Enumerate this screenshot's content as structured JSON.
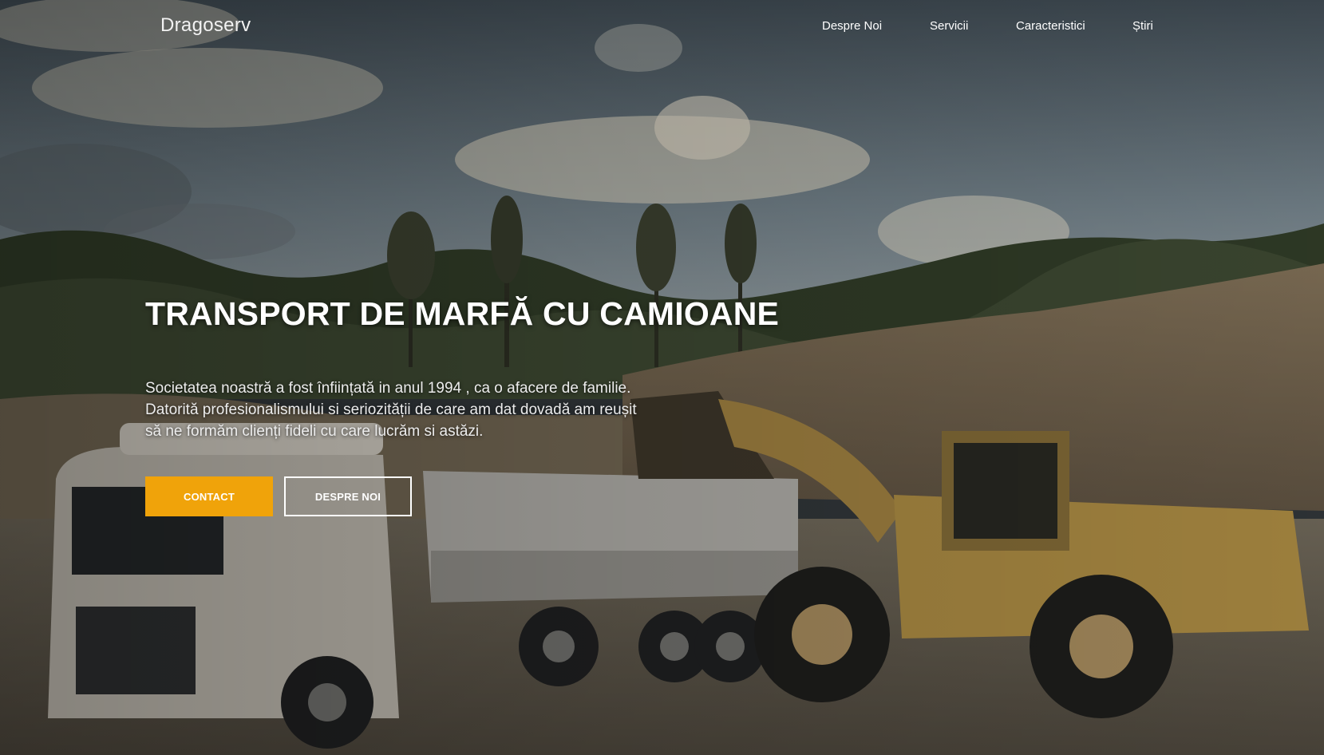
{
  "colors": {
    "accent": "#f0a30a",
    "text": "#ffffff"
  },
  "nav": {
    "brand": "Dragoserv",
    "links": [
      {
        "label": "Despre Noi"
      },
      {
        "label": "Servicii"
      },
      {
        "label": "Caracteristici"
      },
      {
        "label": "Știri"
      }
    ]
  },
  "hero": {
    "headline": "TRANSPORT DE MARFĂ CU CAMIOANE",
    "lead_lines": [
      "Societatea noastră a fost înființată in anul 1994 , ca o afacere de familie.",
      "Datorită profesionalismului si seriozității de care am dat dovadă am reușit",
      "să ne formăm clienți fideli cu care lucrăm si astăzi."
    ],
    "contact_label": "CONTACT",
    "about_label": "DESPRE NOI"
  }
}
